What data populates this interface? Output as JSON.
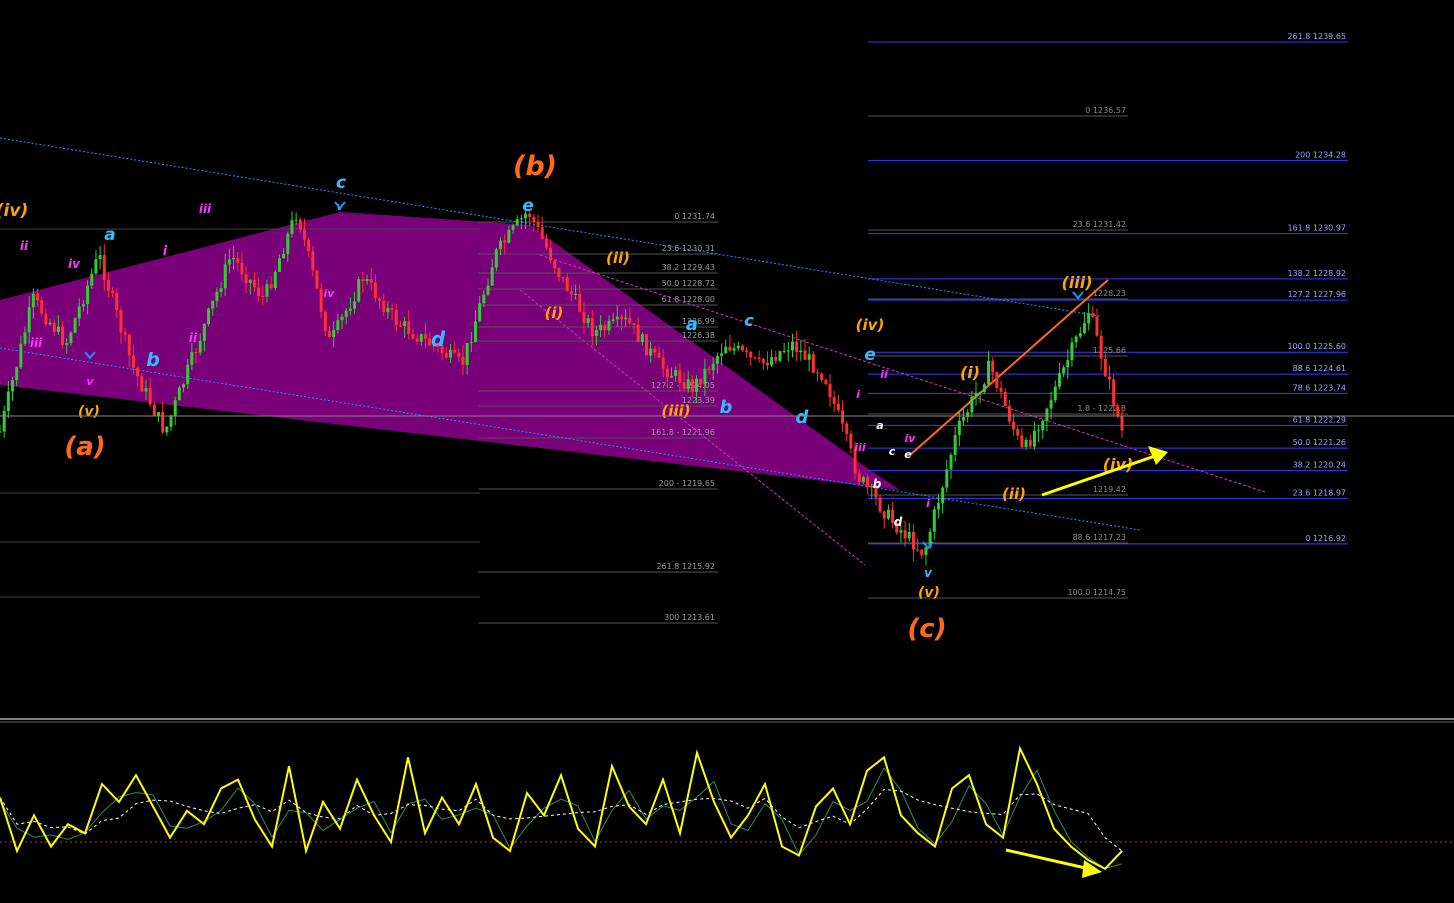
{
  "colors": {
    "background": "#000000",
    "bull_candle": "#32cd32",
    "bear_candle": "#ff3030",
    "triangle_fill": "#800080",
    "fib_line_blue": "#3a3aff",
    "fib_line_gray": "#555555",
    "channel_blue": "#1e90ff",
    "channel_magenta": "#cc33cc",
    "impulse_line": "#ff6a1a",
    "oscillator_main": "#ffff00",
    "oscillator_signal": "#ffffff",
    "arrow": "#ffff00",
    "orange_label": "#ff6a1a",
    "amber_label": "#ffa500",
    "cyan_label": "#33bbff",
    "magenta_label": "#ff33ff",
    "white_label": "#ffffff"
  },
  "chart_data": [
    {
      "type": "candlestick",
      "title": "",
      "price_scale_reference": [
        {
          "price": 1239.65,
          "y_label": "261.8"
        },
        {
          "price": 1213.61,
          "y_label": "300"
        }
      ],
      "path_price": [
        1222,
        1228,
        1226,
        1230,
        1225,
        1222,
        1226,
        1230,
        1228,
        1232,
        1226,
        1229,
        1227,
        1226,
        1225,
        1230,
        1232.0,
        1229,
        1226.5,
        1227,
        1225,
        1224,
        1226,
        1225,
        1226,
        1224.5,
        1220,
        1218,
        1216.5,
        1222,
        1225,
        1221,
        1224,
        1227.5,
        1222
      ],
      "fib_levels_right": [
        {
          "pct": "261.8",
          "price": "1239.65"
        },
        {
          "pct": "200",
          "price": "1234.28"
        },
        {
          "pct": "161.8",
          "price": "1230.97"
        },
        {
          "pct": "138.2",
          "price": "1228.92"
        },
        {
          "pct": "127.2",
          "price": "1227.96"
        },
        {
          "pct": "100.0",
          "price": "1225.60"
        },
        {
          "pct": "88.6",
          "price": "1224.61"
        },
        {
          "pct": "78.6",
          "price": "1223.74"
        },
        {
          "pct": "61.8",
          "price": "1222.29"
        },
        {
          "pct": "50.0",
          "price": "1221.26"
        },
        {
          "pct": "38.2",
          "price": "1220.24"
        },
        {
          "pct": "23.6",
          "price": "1218.97"
        },
        {
          "pct": "0",
          "price": "1216.92"
        }
      ],
      "fib_levels_middle": [
        {
          "label": "0 1236.57"
        },
        {
          "label": "23.6 1231.42"
        },
        {
          "label": "1228.23"
        },
        {
          "label": "1225.66"
        },
        {
          "label": "1.8 - 1222.8"
        },
        {
          "label": "1219.42"
        },
        {
          "label": "88.6 1217.23"
        },
        {
          "label": "100.0 1214.75"
        }
      ],
      "fib_levels_left": [
        {
          "label": "0 1231.74"
        },
        {
          "label": "23.6 1230.31"
        },
        {
          "label": "38.2 1229.43"
        },
        {
          "label": "50.0 1228.72"
        },
        {
          "label": "61.8 1228.00"
        },
        {
          "label": "1226.99"
        },
        {
          "label": "1226.38"
        },
        {
          "label": "127.2 - 1224.05"
        },
        {
          "label": "1223.39"
        },
        {
          "label": "161.8 - 1221.96"
        },
        {
          "label": "200 - 1219.65"
        },
        {
          "label": "261.8 1215.92"
        },
        {
          "label": "300 1213.61"
        }
      ],
      "wave_labels": [
        {
          "text": "(iv)",
          "color": "amber"
        },
        {
          "text": "ii",
          "color": "magenta"
        },
        {
          "text": "a",
          "color": "cyan"
        },
        {
          "text": "iii",
          "color": "magenta"
        },
        {
          "text": "iv",
          "color": "magenta"
        },
        {
          "text": "i",
          "color": "magenta"
        },
        {
          "text": "c",
          "color": "cyan"
        },
        {
          "text": "v",
          "color": "cyan"
        },
        {
          "text": "iii",
          "color": "magenta"
        },
        {
          "text": "ii",
          "color": "magenta"
        },
        {
          "text": "iv",
          "color": "magenta"
        },
        {
          "text": "b",
          "color": "cyan"
        },
        {
          "text": "v",
          "color": "magenta"
        },
        {
          "text": "(v)",
          "color": "amber"
        },
        {
          "text": "(a)",
          "color": "orange"
        },
        {
          "text": "d",
          "color": "cyan"
        },
        {
          "text": "(b)",
          "color": "orange"
        },
        {
          "text": "e",
          "color": "cyan"
        },
        {
          "text": "(ii)",
          "color": "amber"
        },
        {
          "text": "(i)",
          "color": "amber"
        },
        {
          "text": "a",
          "color": "cyan"
        },
        {
          "text": "c",
          "color": "cyan"
        },
        {
          "text": "(iv)",
          "color": "amber"
        },
        {
          "text": "e",
          "color": "cyan"
        },
        {
          "text": "ii",
          "color": "magenta"
        },
        {
          "text": "i",
          "color": "magenta"
        },
        {
          "text": "(iii)",
          "color": "amber"
        },
        {
          "text": "b",
          "color": "cyan"
        },
        {
          "text": "d",
          "color": "cyan"
        },
        {
          "text": "a",
          "color": "white"
        },
        {
          "text": "iii",
          "color": "magenta"
        },
        {
          "text": "c",
          "color": "white"
        },
        {
          "text": "e",
          "color": "white"
        },
        {
          "text": "iv",
          "color": "magenta"
        },
        {
          "text": "b",
          "color": "white"
        },
        {
          "text": "d",
          "color": "white"
        },
        {
          "text": "i",
          "color": "magenta"
        },
        {
          "text": "v",
          "color": "cyan"
        },
        {
          "text": "(v)",
          "color": "amber"
        },
        {
          "text": "(c)",
          "color": "orange"
        },
        {
          "text": "(i)",
          "color": "amber"
        },
        {
          "text": "(ii)",
          "color": "amber"
        },
        {
          "text": "(iii)",
          "color": "amber"
        },
        {
          "text": "(iv)",
          "color": "amber"
        }
      ]
    },
    {
      "type": "line",
      "title": "",
      "series": [
        {
          "values": [
            52,
            28,
            44,
            30,
            40,
            36,
            58,
            50,
            62,
            48,
            34,
            46,
            40,
            56,
            60,
            42,
            30,
            66,
            28,
            50,
            38,
            60,
            44,
            32,
            70,
            36,
            52,
            40,
            58,
            34,
            28,
            54,
            44,
            62,
            38,
            30,
            66,
            48,
            40,
            60,
            36,
            72,
            50,
            34,
            44,
            58,
            30,
            26,
            48,
            56,
            40,
            64,
            70,
            44,
            36,
            30,
            56,
            62,
            40,
            34,
            74,
            58,
            38,
            30,
            24,
            20,
            28
          ]
        }
      ]
    }
  ]
}
